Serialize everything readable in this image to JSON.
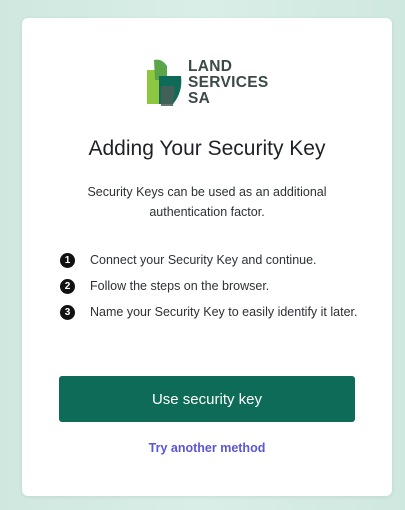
{
  "brand": {
    "logo_lines": [
      "LAND",
      "SERVICES",
      "SA"
    ],
    "colors": {
      "leaf_light": "#8dc63f",
      "leaf_dark": "#0d6b57",
      "leaf_mid": "#5aa548",
      "text": "#3b4a47"
    }
  },
  "page": {
    "title": "Adding Your Security Key",
    "description": "Security Keys can be used as an additional authentication factor."
  },
  "steps": [
    {
      "number": "1",
      "text": "Connect your Security Key and continue."
    },
    {
      "number": "2",
      "text": "Follow the steps on the browser."
    },
    {
      "number": "3",
      "text": "Name your Security Key to easily identify it later."
    }
  ],
  "actions": {
    "primary_label": "Use security key",
    "secondary_label": "Try another method"
  },
  "theme": {
    "primary_button_color": "#0d6b57",
    "link_color": "#5b56d6",
    "background_color": "#cfe8df"
  }
}
